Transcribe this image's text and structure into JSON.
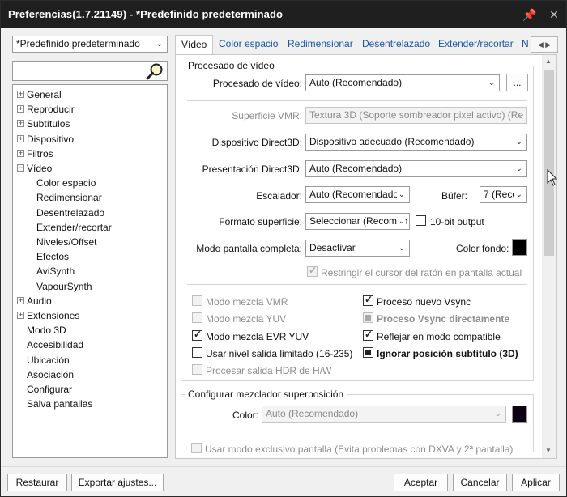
{
  "window": {
    "title": "Preferencias(1.7.21149) - *Predefinido predeterminado",
    "pin_glyph": "📌",
    "close_glyph": "✕"
  },
  "preset": {
    "value": "*Predefinido predeterminado"
  },
  "search": {
    "value": "",
    "icon": "magnifier-icon"
  },
  "tree": {
    "items": [
      {
        "label": "General",
        "expander": "+"
      },
      {
        "label": "Reproducir",
        "expander": "+"
      },
      {
        "label": "Subtítulos",
        "expander": "+"
      },
      {
        "label": "Dispositivo",
        "expander": "+"
      },
      {
        "label": "Filtros",
        "expander": "+"
      },
      {
        "label": "Vídeo",
        "expander": "−"
      },
      {
        "label": "Color espacio"
      },
      {
        "label": "Redimensionar"
      },
      {
        "label": "Desentrelazado"
      },
      {
        "label": "Extender/recortar"
      },
      {
        "label": "Niveles/Offset"
      },
      {
        "label": "Efectos"
      },
      {
        "label": "AviSynth"
      },
      {
        "label": "VapourSynth"
      },
      {
        "label": "Audio",
        "expander": "+"
      },
      {
        "label": "Extensiones",
        "expander": "+"
      },
      {
        "label": "Modo 3D"
      },
      {
        "label": "Accesibilidad"
      },
      {
        "label": "Ubicación"
      },
      {
        "label": "Asociación"
      },
      {
        "label": "Configurar"
      },
      {
        "label": "Salva pantallas"
      }
    ]
  },
  "tabs": {
    "items": [
      "Vídeo",
      "Color espacio",
      "Redimensionar",
      "Desentrelazado",
      "Extender/recortar",
      "N"
    ],
    "active": "Vídeo",
    "scroll_left": "◀",
    "scroll_right": "▶"
  },
  "processing": {
    "group_title": "Procesado de vídeo",
    "video_processing": {
      "label": "Procesado de vídeo:",
      "value": "Auto (Recomendado)",
      "more_button": "..."
    },
    "vmr_surface": {
      "label": "Superficie VMR:",
      "value": "Textura 3D (Soporte sombreador pixel activo) (Re"
    },
    "d3d_device": {
      "label": "Dispositivo Direct3D:",
      "value": "Dispositivo adecuado (Recomendado)"
    },
    "d3d_presentation": {
      "label": "Presentación Direct3D:",
      "value": "Auto (Recomendado)"
    },
    "scaler": {
      "label": "Escalador:",
      "value": "Auto (Recomendado)"
    },
    "buffer": {
      "label": "Búfer:",
      "value": "7 (Reco"
    },
    "surface_format": {
      "label": "Formato superficie:",
      "value": "Seleccionar (Recomen"
    },
    "ten_bit": {
      "label": "10-bit output",
      "checked": false
    },
    "fullscreen_mode": {
      "label": "Modo pantalla completa:",
      "value": "Desactivar"
    },
    "bg_color": {
      "label": "Color fondo:",
      "color": "#000000"
    },
    "restrict_cursor": {
      "label": "Restringir el cursor del ratón en pantalla actual",
      "checked": true,
      "disabled": true
    }
  },
  "options": {
    "left": [
      {
        "label": "Modo mezcla VMR",
        "checked": false,
        "disabled": true
      },
      {
        "label": "Modo mezcla YUV",
        "checked": false,
        "disabled": true
      },
      {
        "label": "Modo mezcla EVR YUV",
        "checked": true,
        "disabled": false
      },
      {
        "label": "Usar nivel salida limitado (16-235)",
        "checked": false,
        "disabled": false
      },
      {
        "label": "Procesar salida HDR de H/W",
        "checked": false,
        "disabled": true
      }
    ],
    "right": [
      {
        "label": "Proceso nuevo Vsync",
        "checked": true,
        "disabled": false,
        "bold": false
      },
      {
        "label": "Proceso Vsync directamente",
        "indeterminate": true,
        "disabled": true,
        "bold": true
      },
      {
        "label": "Reflejar en modo compatible",
        "checked": true,
        "disabled": false,
        "bold": false
      },
      {
        "label": "Ignorar posición subtítulo (3D)",
        "indeterminate": true,
        "disabled": false,
        "bold": true
      }
    ]
  },
  "overlay": {
    "group_title": "Configurar mezclador superposición",
    "color": {
      "label": "Color:",
      "value": "Auto (Recomendado)",
      "swatch": "#0d0014"
    },
    "exclusive": {
      "label": "Usar modo exclusivo pantalla (Evita problemas con DXVA y 2ª pantalla)",
      "checked": false,
      "disabled": true
    }
  },
  "footer": {
    "restore": "Restaurar",
    "export": "Exportar ajustes...",
    "accept": "Aceptar",
    "cancel": "Cancelar",
    "apply": "Aplicar"
  },
  "colors": {
    "title_bar": "#1f1f1f",
    "link_tab": "#1a56a8",
    "disabled_text": "#8d8d8d"
  }
}
